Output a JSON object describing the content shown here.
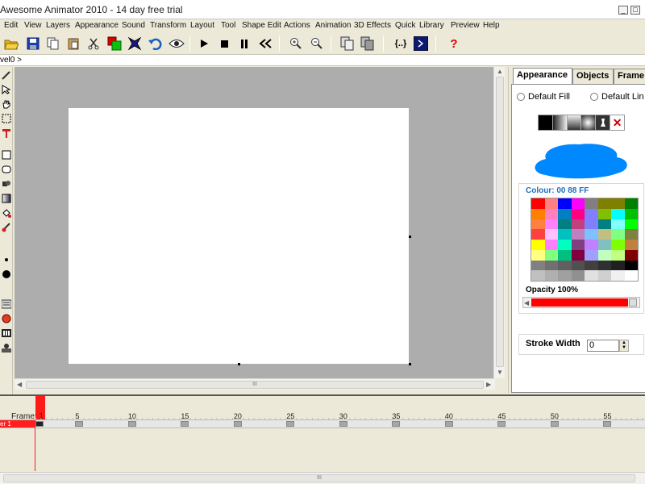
{
  "window": {
    "title": "Awesome Animator 2010 - 14 day free trial"
  },
  "menu": [
    "Edit",
    "View",
    "Layers",
    "Appearance",
    "Sound",
    "Transform",
    "Layout",
    "Tool",
    "Shape Edit",
    "Actions",
    "Animation",
    "3D Effects",
    "Quick",
    "Library",
    "Preview",
    "Help"
  ],
  "toolbar": {
    "icons": [
      "open-folder-icon",
      "save-icon",
      "copy-icon",
      "paste-icon",
      "cut-icon",
      "fill-color-icon",
      "transform-icon",
      "undo-icon",
      "preview-eye-icon",
      "play-icon",
      "stop-icon",
      "pause-icon",
      "rewind-icon",
      "zoom-in-icon",
      "zoom-out-icon",
      "duplicate-icon",
      "stack-icon",
      "script-braces-icon",
      "console-icon",
      "help-icon"
    ],
    "script_label": "{..}",
    "help_label": "?"
  },
  "breadcrumb": {
    "path": "vel0 >"
  },
  "panel": {
    "tabs": [
      "Appearance",
      "Objects",
      "Frame"
    ],
    "active_tab": "Appearance",
    "default_fill_label": "Default Fill",
    "default_line_label": "Default Lin",
    "colour_label": "Colour: 00 88 FF",
    "current_colour": "#0088ff",
    "opacity_label": "Opacity  100%",
    "opacity_value": 100,
    "stroke_width_label": "Stroke Width",
    "stroke_width_value": "0",
    "palette_colors": [
      "#ff0000",
      "#ff8080",
      "#0000ff",
      "#ff00ff",
      "#808080",
      "#808000",
      "#808000",
      "#008000",
      "#ff8000",
      "#ff80c0",
      "#0080c0",
      "#ff0080",
      "#8080ff",
      "#80c000",
      "#00ffff",
      "#00c000",
      "#ff8040",
      "#ff80ff",
      "#008080",
      "#c04080",
      "#8080ff",
      "#008080",
      "#80ffff",
      "#00ff00",
      "#ff4040",
      "#ffc0ff",
      "#00c0c0",
      "#c080c0",
      "#80c0ff",
      "#c0c080",
      "#80ff80",
      "#808040",
      "#ffff00",
      "#ff80ff",
      "#00ffc0",
      "#804080",
      "#c080ff",
      "#80c0c0",
      "#80ff00",
      "#c08040",
      "#ffff80",
      "#80ff80",
      "#00c080",
      "#800040",
      "#a0a0ff",
      "#c0ffc0",
      "#c0ff80",
      "#800000",
      "#808080",
      "#707070",
      "#606060",
      "#505050",
      "#404040",
      "#303030",
      "#202020",
      "#000000",
      "#c0c0c0",
      "#b0b0b0",
      "#a0a0a0",
      "#909090",
      "#e0e0e0",
      "#d0d0d0",
      "#f0f0f0",
      "#ffffff"
    ]
  },
  "timeline": {
    "frame_label": "Frame: 1",
    "layer_label": "er 1",
    "frame_numbers": [
      "5",
      "10",
      "15",
      "20",
      "25",
      "30",
      "35",
      "40",
      "45",
      "50",
      "55"
    ],
    "current_frame": 1
  }
}
